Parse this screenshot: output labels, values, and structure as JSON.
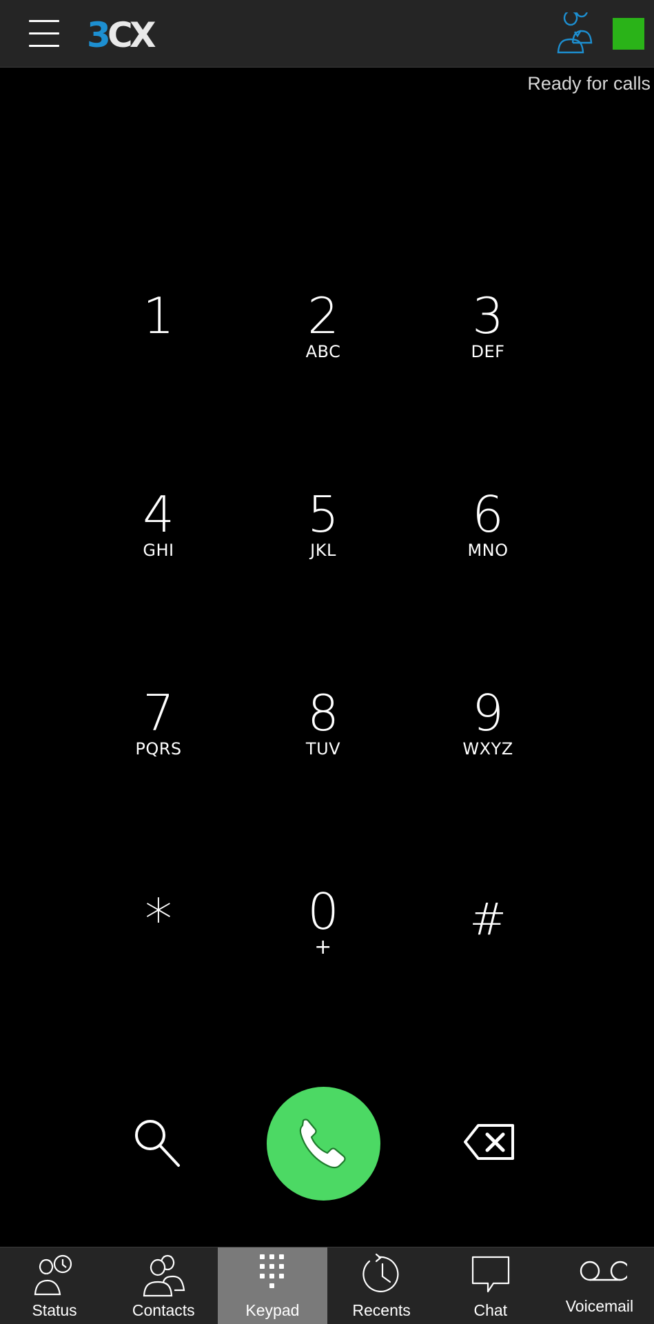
{
  "header": {
    "logo_text": "3CX",
    "status_text": "Ready for calls",
    "status_color": "#2ab318",
    "logo_blue": "#1d8fd1"
  },
  "keypad": {
    "keys": [
      {
        "digit": "1",
        "letters": ""
      },
      {
        "digit": "2",
        "letters": "ABC"
      },
      {
        "digit": "3",
        "letters": "DEF"
      },
      {
        "digit": "4",
        "letters": "GHI"
      },
      {
        "digit": "5",
        "letters": "JKL"
      },
      {
        "digit": "6",
        "letters": "MNO"
      },
      {
        "digit": "7",
        "letters": "PQRS"
      },
      {
        "digit": "8",
        "letters": "TUV"
      },
      {
        "digit": "9",
        "letters": "WXYZ"
      },
      {
        "digit": "*",
        "letters": ""
      },
      {
        "digit": "0",
        "letters": "+"
      },
      {
        "digit": "#",
        "letters": ""
      }
    ],
    "actions": {
      "search_icon": "search-icon",
      "call_icon": "phone-icon",
      "call_color": "#4cd964",
      "backspace_icon": "backspace-icon"
    }
  },
  "nav": {
    "items": [
      {
        "label": "Status",
        "icon": "status-clock-person-icon"
      },
      {
        "label": "Contacts",
        "icon": "contacts-icon"
      },
      {
        "label": "Keypad",
        "icon": "keypad-icon",
        "active": true
      },
      {
        "label": "Recents",
        "icon": "recents-icon"
      },
      {
        "label": "Chat",
        "icon": "chat-icon"
      },
      {
        "label": "Voicemail",
        "icon": "voicemail-icon"
      }
    ]
  }
}
